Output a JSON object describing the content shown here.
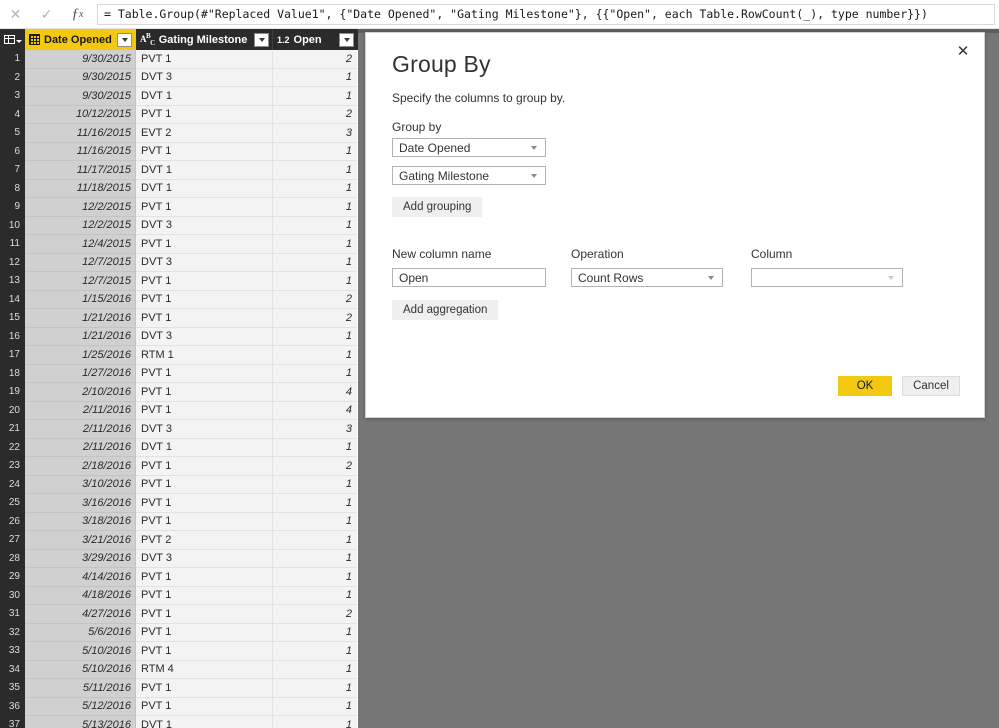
{
  "formula_bar": {
    "cancel_icon": "close-icon",
    "accept_icon": "check-icon",
    "fx_icon": "fx",
    "formula": "= Table.Group(#\"Replaced Value1\", {\"Date Opened\", \"Gating Milestone\"}, {{\"Open\", each Table.RowCount(_), type number}})"
  },
  "grid": {
    "columns": [
      {
        "label": "Date Opened",
        "type_icon": "date-icon",
        "selected": true
      },
      {
        "label": "Gating Milestone",
        "type_icon": "abc-text-icon",
        "selected": false
      },
      {
        "label": "Open",
        "type_icon": "1.2",
        "selected": false
      }
    ],
    "rows": [
      {
        "n": "1",
        "date": "9/30/2015",
        "milestone": "PVT 1",
        "open": "2"
      },
      {
        "n": "2",
        "date": "9/30/2015",
        "milestone": "DVT 3",
        "open": "1"
      },
      {
        "n": "3",
        "date": "9/30/2015",
        "milestone": "DVT 1",
        "open": "1"
      },
      {
        "n": "4",
        "date": "10/12/2015",
        "milestone": "PVT 1",
        "open": "2"
      },
      {
        "n": "5",
        "date": "11/16/2015",
        "milestone": "EVT 2",
        "open": "3"
      },
      {
        "n": "6",
        "date": "11/16/2015",
        "milestone": "PVT 1",
        "open": "1"
      },
      {
        "n": "7",
        "date": "11/17/2015",
        "milestone": "DVT 1",
        "open": "1"
      },
      {
        "n": "8",
        "date": "11/18/2015",
        "milestone": "DVT 1",
        "open": "1"
      },
      {
        "n": "9",
        "date": "12/2/2015",
        "milestone": "PVT 1",
        "open": "1"
      },
      {
        "n": "10",
        "date": "12/2/2015",
        "milestone": "DVT 3",
        "open": "1"
      },
      {
        "n": "11",
        "date": "12/4/2015",
        "milestone": "PVT 1",
        "open": "1"
      },
      {
        "n": "12",
        "date": "12/7/2015",
        "milestone": "DVT 3",
        "open": "1"
      },
      {
        "n": "13",
        "date": "12/7/2015",
        "milestone": "PVT 1",
        "open": "1"
      },
      {
        "n": "14",
        "date": "1/15/2016",
        "milestone": "PVT 1",
        "open": "2"
      },
      {
        "n": "15",
        "date": "1/21/2016",
        "milestone": "PVT 1",
        "open": "2"
      },
      {
        "n": "16",
        "date": "1/21/2016",
        "milestone": "DVT 3",
        "open": "1"
      },
      {
        "n": "17",
        "date": "1/25/2016",
        "milestone": "RTM 1",
        "open": "1"
      },
      {
        "n": "18",
        "date": "1/27/2016",
        "milestone": "PVT 1",
        "open": "1"
      },
      {
        "n": "19",
        "date": "2/10/2016",
        "milestone": "PVT 1",
        "open": "4"
      },
      {
        "n": "20",
        "date": "2/11/2016",
        "milestone": "PVT 1",
        "open": "4"
      },
      {
        "n": "21",
        "date": "2/11/2016",
        "milestone": "DVT 3",
        "open": "3"
      },
      {
        "n": "22",
        "date": "2/11/2016",
        "milestone": "DVT 1",
        "open": "1"
      },
      {
        "n": "23",
        "date": "2/18/2016",
        "milestone": "PVT 1",
        "open": "2"
      },
      {
        "n": "24",
        "date": "3/10/2016",
        "milestone": "PVT 1",
        "open": "1"
      },
      {
        "n": "25",
        "date": "3/16/2016",
        "milestone": "PVT 1",
        "open": "1"
      },
      {
        "n": "26",
        "date": "3/18/2016",
        "milestone": "PVT 1",
        "open": "1"
      },
      {
        "n": "27",
        "date": "3/21/2016",
        "milestone": "PVT 2",
        "open": "1"
      },
      {
        "n": "28",
        "date": "3/29/2016",
        "milestone": "DVT 3",
        "open": "1"
      },
      {
        "n": "29",
        "date": "4/14/2016",
        "milestone": "PVT 1",
        "open": "1"
      },
      {
        "n": "30",
        "date": "4/18/2016",
        "milestone": "PVT 1",
        "open": "1"
      },
      {
        "n": "31",
        "date": "4/27/2016",
        "milestone": "PVT 1",
        "open": "2"
      },
      {
        "n": "32",
        "date": "5/6/2016",
        "milestone": "PVT 1",
        "open": "1"
      },
      {
        "n": "33",
        "date": "5/10/2016",
        "milestone": "PVT 1",
        "open": "1"
      },
      {
        "n": "34",
        "date": "5/10/2016",
        "milestone": "RTM 4",
        "open": "1"
      },
      {
        "n": "35",
        "date": "5/11/2016",
        "milestone": "PVT 1",
        "open": "1"
      },
      {
        "n": "36",
        "date": "5/12/2016",
        "milestone": "PVT 1",
        "open": "1"
      },
      {
        "n": "37",
        "date": "5/13/2016",
        "milestone": "DVT 1",
        "open": "1"
      }
    ]
  },
  "dialog": {
    "title": "Group By",
    "subtitle": "Specify the columns to group by.",
    "close_label": "✕",
    "group_by_label": "Group by",
    "group_by_values": [
      "Date Opened",
      "Gating Milestone"
    ],
    "add_grouping_label": "Add grouping",
    "new_column_label": "New column name",
    "new_column_value": "Open",
    "operation_label": "Operation",
    "operation_value": "Count Rows",
    "column_label": "Column",
    "column_value": "",
    "add_aggregation_label": "Add aggregation",
    "ok_label": "OK",
    "cancel_label": "Cancel",
    "accent_color": "#f2c811"
  }
}
